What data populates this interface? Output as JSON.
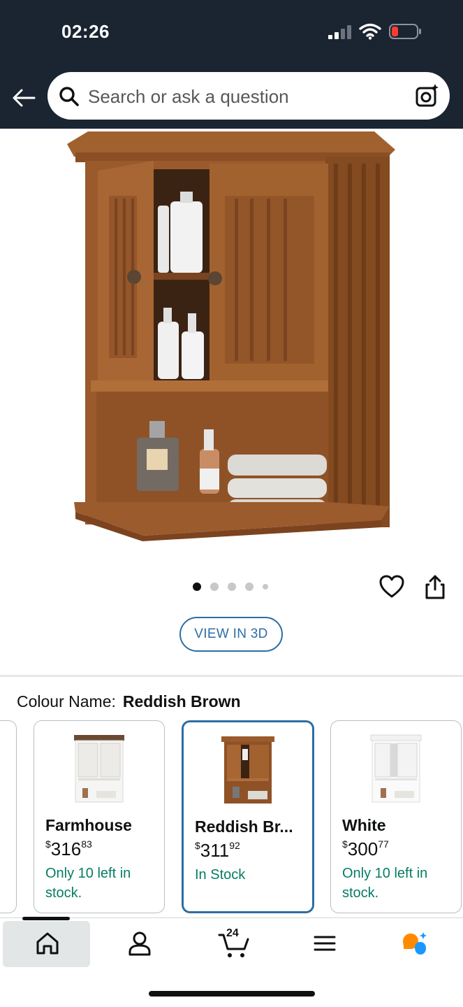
{
  "status_bar": {
    "time": "02:26",
    "icons": [
      "signal-icon",
      "wifi-icon",
      "battery-low-icon"
    ]
  },
  "header": {
    "back_icon": "arrow-left-icon",
    "search_placeholder": "Search or ask a question",
    "camera_icon": "camera-sparkle-icon"
  },
  "gallery": {
    "image_count": 5,
    "active_index": 0,
    "view_3d_label": "VIEW IN 3D"
  },
  "colour": {
    "label": "Colour Name:",
    "value": "Reddish Brown"
  },
  "swatches": [
    {
      "name": "Farmhouse",
      "price_currency": "$",
      "price_whole": "316",
      "price_fraction": "83",
      "stock": "Only 10 left in stock.",
      "color": "#ffffff",
      "selected": false
    },
    {
      "name": "Reddish Br...",
      "price_currency": "$",
      "price_whole": "311",
      "price_fraction": "92",
      "stock": "In Stock",
      "color": "#8b4a22",
      "selected": true
    },
    {
      "name": "White",
      "price_currency": "$",
      "price_whole": "300",
      "price_fraction": "77",
      "stock": "Only 10 left in stock.",
      "color": "#ffffff",
      "selected": false
    }
  ],
  "bottom_nav": {
    "items": [
      "home-icon",
      "account-icon",
      "cart-icon",
      "menu-icon",
      "rufus-icon"
    ],
    "cart_count": "24"
  },
  "colors": {
    "header_bg": "#1b2431",
    "accent_blue": "#2d6da3",
    "stock_green": "#067d62",
    "wood": "#9a5a2c"
  }
}
